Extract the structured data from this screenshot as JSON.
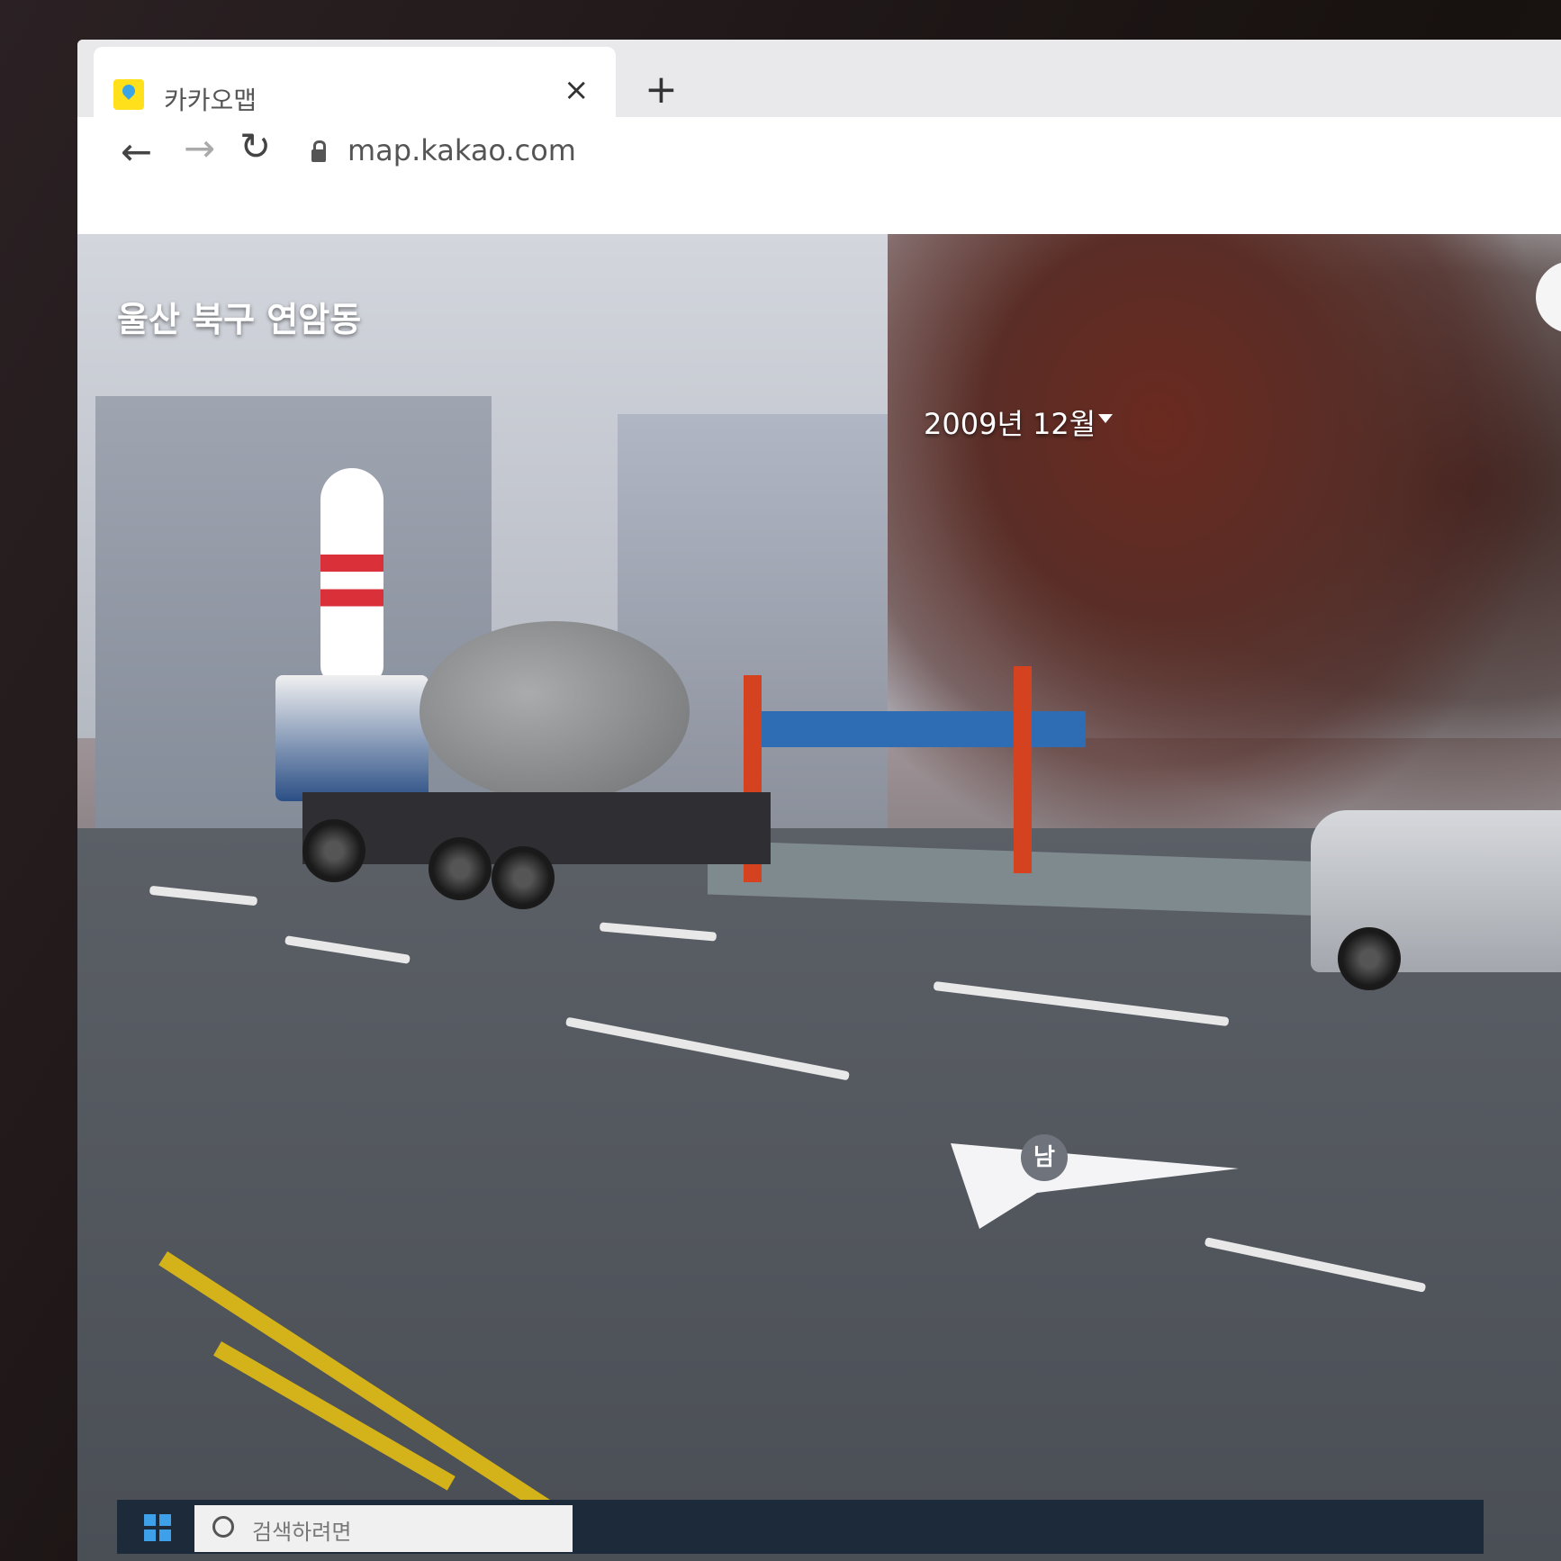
{
  "browser": {
    "tab_title": "카카오맵",
    "tab_close": "×",
    "new_tab": "+",
    "url": "map.kakao.com",
    "back": "←",
    "forward": "→",
    "reload": "↻"
  },
  "roadview": {
    "location": "울산 북구 연암동",
    "date": "2009년 12월",
    "compass_label": "남"
  },
  "taskbar": {
    "search_placeholder": "검색하려면"
  },
  "colors": {
    "kakao_yellow": "#ffe01b",
    "taskbar": "#1d2a3a"
  }
}
